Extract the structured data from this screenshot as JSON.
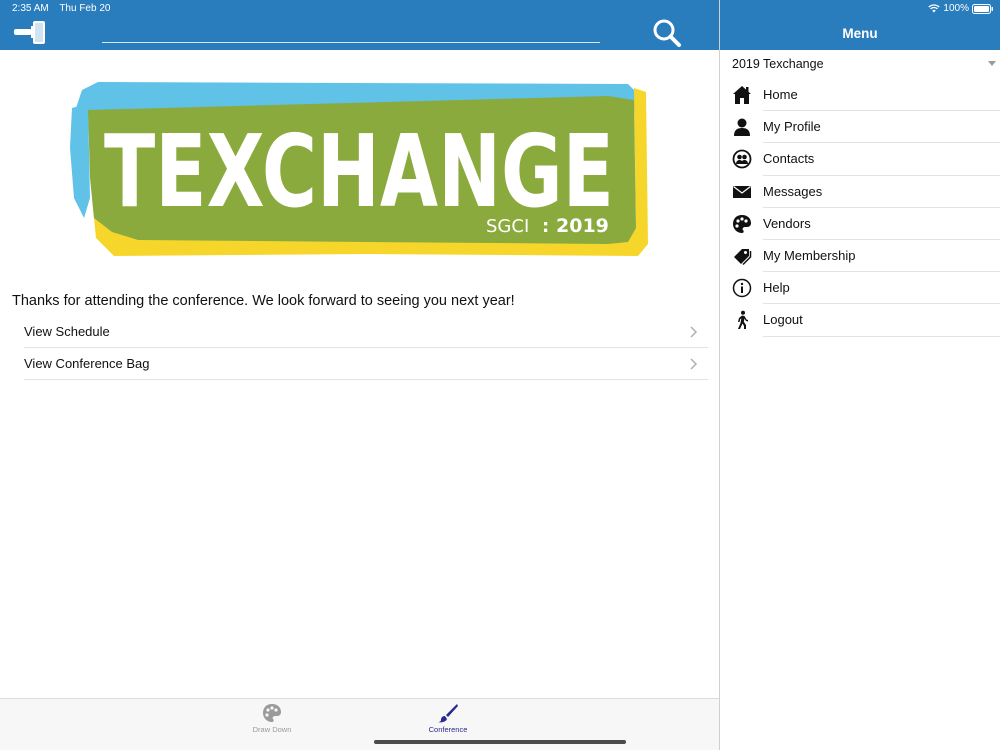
{
  "status_bar": {
    "time": "2:35 AM",
    "date": "Thu Feb 20",
    "battery": "100%"
  },
  "colors": {
    "header_blue": "#2a7dbd",
    "logo_green": "#8aaa3d",
    "logo_blue": "#5fc2e6",
    "logo_yellow": "#f7d62c",
    "tab_active": "#2a2a8e",
    "tab_inactive": "#9a9a9a"
  },
  "main": {
    "thanks_message": "Thanks for attending the conference. We look forward to seeing you next year!",
    "rows": [
      {
        "label": "View Schedule",
        "icon": "chevron-right-icon"
      },
      {
        "label": "View Conference Bag",
        "icon": "chevron-right-icon"
      }
    ]
  },
  "logo": {
    "word": "TEXCHANGE",
    "org": "SGCI",
    "sep": ":",
    "year": "2019"
  },
  "tabbar": {
    "tabs": [
      {
        "label": "Draw Down",
        "icon": "palette-icon",
        "active": false
      },
      {
        "label": "Conference",
        "icon": "brush-icon",
        "active": true
      }
    ]
  },
  "menu": {
    "title": "Menu",
    "selected_conference": "2019 Texchange",
    "items": [
      {
        "label": "Home",
        "icon": "home-icon"
      },
      {
        "label": "My Profile",
        "icon": "person-icon"
      },
      {
        "label": "Contacts",
        "icon": "contacts-icon"
      },
      {
        "label": "Messages",
        "icon": "envelope-icon"
      },
      {
        "label": "Vendors",
        "icon": "palette-icon"
      },
      {
        "label": "My Membership",
        "icon": "tags-icon"
      },
      {
        "label": "Help",
        "icon": "info-icon"
      },
      {
        "label": "Logout",
        "icon": "walking-person-icon"
      }
    ]
  }
}
